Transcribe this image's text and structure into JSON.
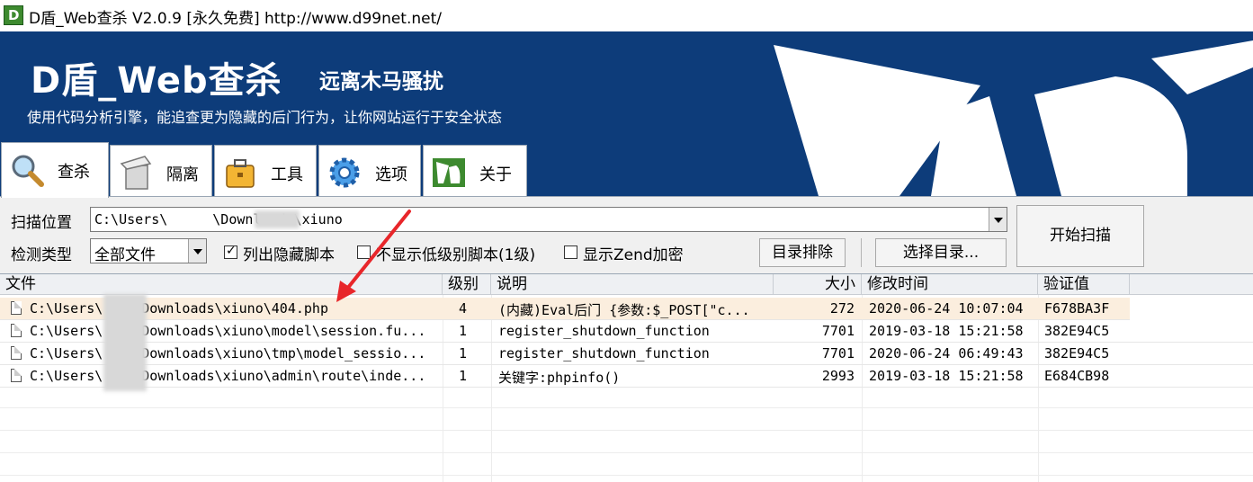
{
  "window": {
    "title": "D盾_Web查杀 V2.0.9 [永久免费] http://www.d99net.net/"
  },
  "banner": {
    "title": "D盾_Web查杀",
    "subtitle": "远离木马骚扰",
    "description": "使用代码分析引擎，能追查更为隐藏的后门行为，让你网站运行于安全状态"
  },
  "tabs": [
    {
      "label": "查杀",
      "icon": "magnifier-icon",
      "active": true
    },
    {
      "label": "隔离",
      "icon": "trash-bin-icon"
    },
    {
      "label": "工具",
      "icon": "toolbox-icon"
    },
    {
      "label": "选项",
      "icon": "gear-icon"
    },
    {
      "label": "关于",
      "icon": "d-logo-icon"
    }
  ],
  "scan": {
    "location_label": "扫描位置",
    "location_value_pre": "C:\\Users\\",
    "location_value_post": "\\Downloads\\xiuno",
    "type_label": "检测类型",
    "type_value": "全部文件",
    "chk_hidden_label": "列出隐藏脚本",
    "chk_hidden_checked": true,
    "chk_low_label": "不显示低级别脚本(1级)",
    "chk_low_checked": false,
    "chk_zend_label": "显示Zend加密",
    "chk_zend_checked": false,
    "exclude_button": "目录排除",
    "select_dir_button": "选择目录...",
    "start_button": "开始扫描"
  },
  "table": {
    "columns": [
      "文件",
      "级别",
      "说明",
      "大小",
      "修改时间",
      "验证值"
    ],
    "rows": [
      {
        "file_pre": "C:\\Users\\",
        "file_post": "Downloads\\xiuno\\404.php",
        "level": "4",
        "desc": "(内藏)Eval后门 {参数:$_POST[\"c...",
        "size": "272",
        "mtime": "2020-06-24 10:07:04",
        "hash": "F678BA3F"
      },
      {
        "file_pre": "C:\\Users\\",
        "file_post": "Downloads\\xiuno\\model\\session.fu...",
        "level": "1",
        "desc": "register_shutdown_function",
        "size": "7701",
        "mtime": "2019-03-18 15:21:58",
        "hash": "382E94C5"
      },
      {
        "file_pre": "C:\\Users\\",
        "file_post": "Downloads\\xiuno\\tmp\\model_sessio...",
        "level": "1",
        "desc": "register_shutdown_function",
        "size": "7701",
        "mtime": "2020-06-24 06:49:43",
        "hash": "382E94C5"
      },
      {
        "file_pre": "C:\\Users\\",
        "file_post": "Downloads\\xiuno\\admin\\route\\inde...",
        "level": "1",
        "desc": "关键字:phpinfo()",
        "size": "2993",
        "mtime": "2019-03-18 15:21:58",
        "hash": "E684CB98"
      }
    ]
  },
  "colors": {
    "banner_bg": "#0d3c7a",
    "selected_row": "#fbeede",
    "arrow": "#e8262a"
  }
}
